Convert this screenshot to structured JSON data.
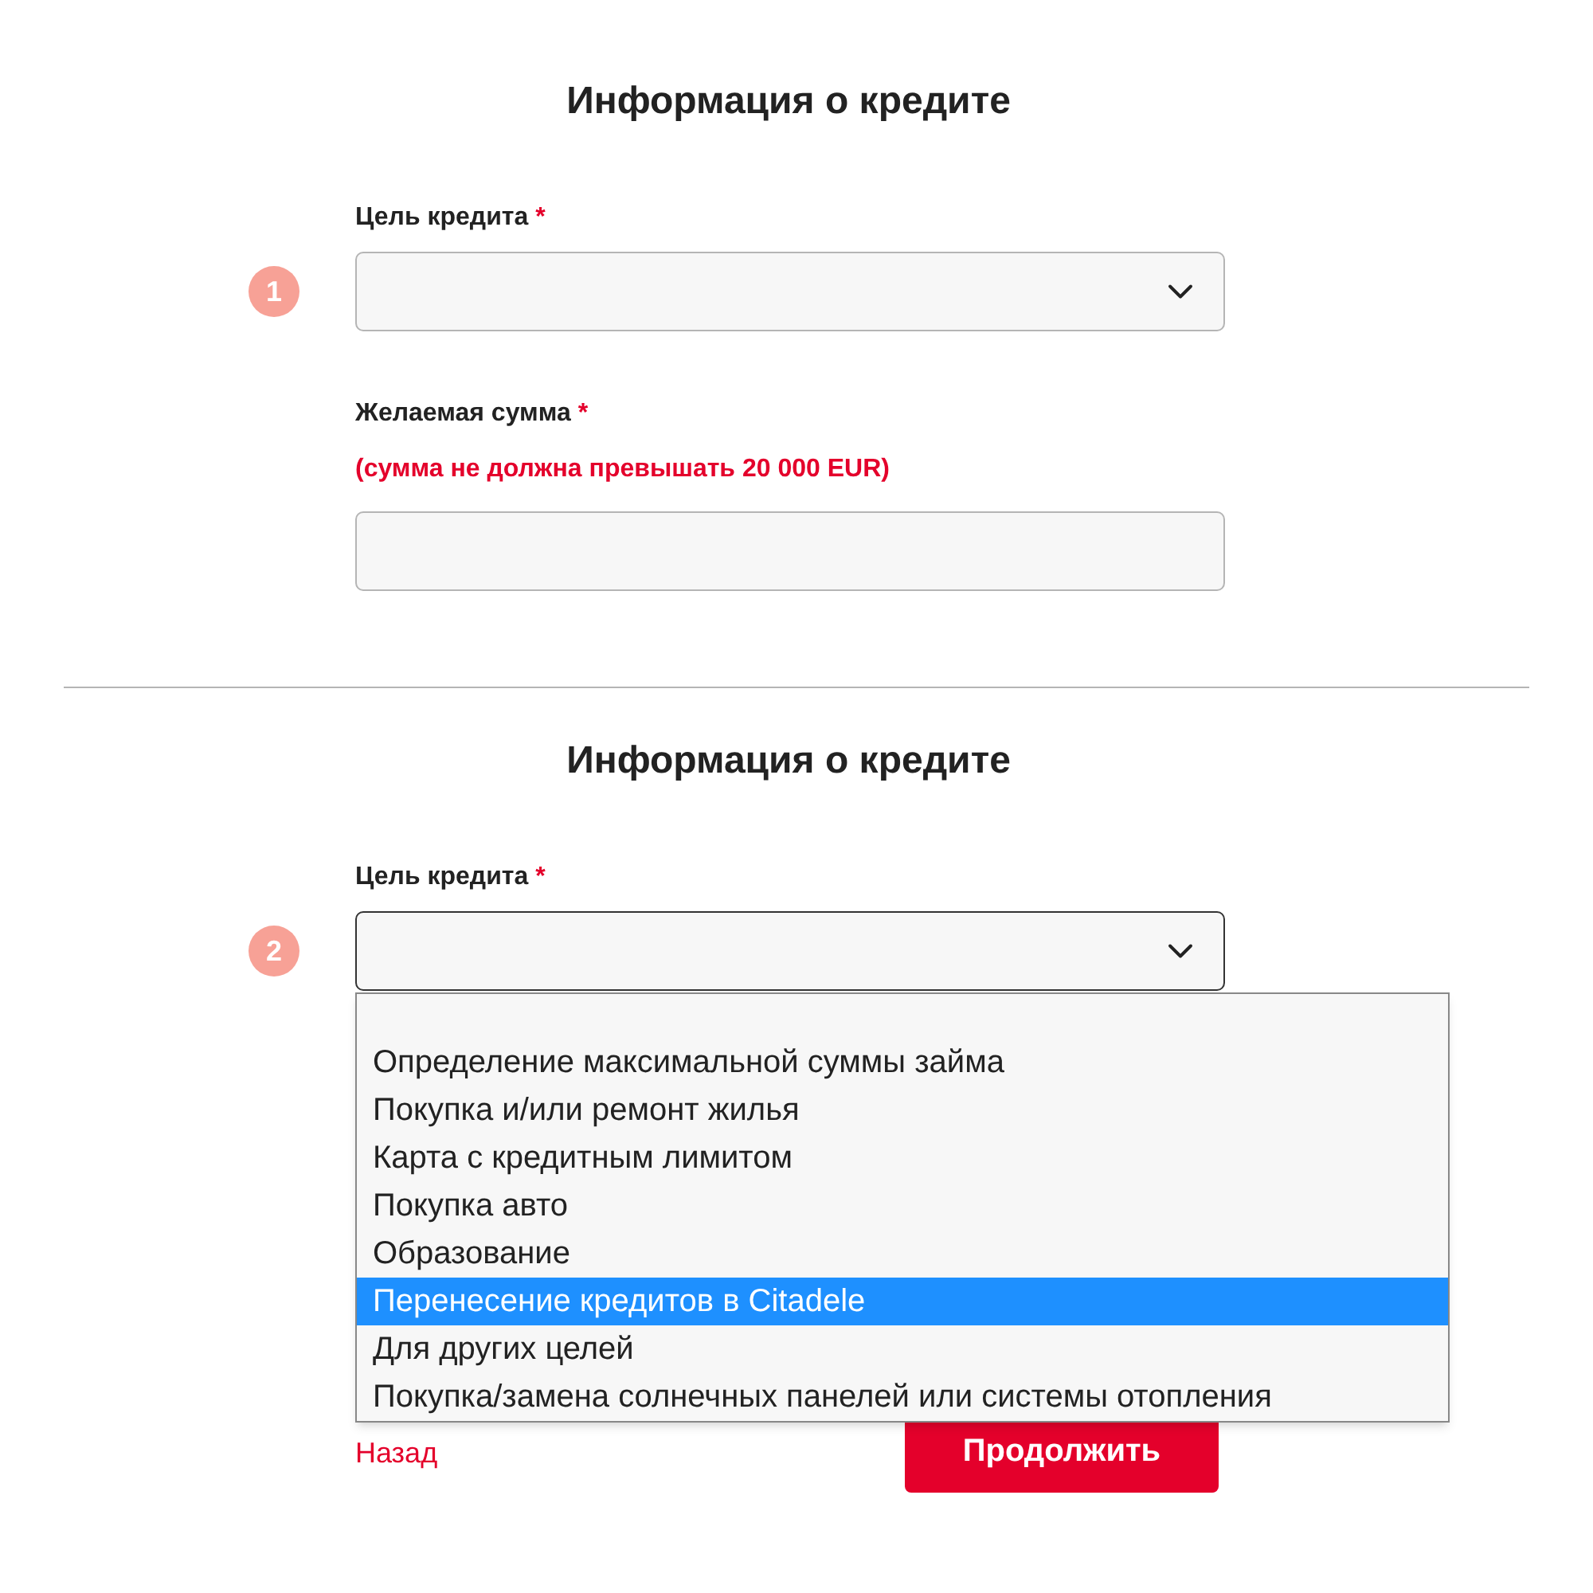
{
  "sections": [
    {
      "badge": "1",
      "title": "Информация о кредите",
      "fields": [
        {
          "kind": "select",
          "label": "Цель кредита",
          "required_mark": "*",
          "focused": false
        },
        {
          "kind": "input",
          "label": "Желаемая сумма",
          "required_mark": "*",
          "hint": "(сумма не должна превышать 20 000 EUR)"
        }
      ]
    },
    {
      "badge": "2",
      "title": "Информация о кредите",
      "fields": [
        {
          "kind": "select",
          "label": "Цель кредита",
          "required_mark": "*",
          "focused": true,
          "options": [
            {
              "label": "Определение максимальной суммы займа",
              "selected": false
            },
            {
              "label": "Покупка и/или ремонт жилья",
              "selected": false
            },
            {
              "label": "Карта с кредитным лимитом",
              "selected": false
            },
            {
              "label": "Покупка авто",
              "selected": false
            },
            {
              "label": "Образование",
              "selected": false
            },
            {
              "label": "Перенесение кредитов в Citadele",
              "selected": true
            },
            {
              "label": "Для других целей",
              "selected": false
            },
            {
              "label": "Покупка/замена солнечных панелей или системы отопления",
              "selected": false
            }
          ]
        }
      ],
      "back_link": "Назад",
      "continue_button": "Продолжить"
    }
  ]
}
